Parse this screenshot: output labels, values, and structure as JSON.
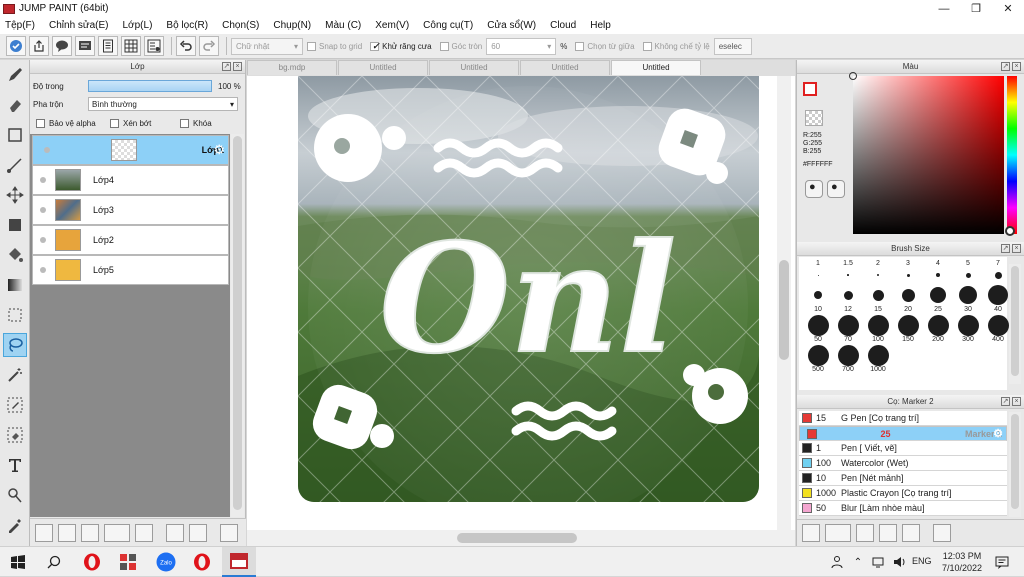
{
  "title": "JUMP PAINT (64bit)",
  "menu": [
    "Tệp(F)",
    "Chỉnh sửa(E)",
    "Lớp(L)",
    "Bộ lọc(R)",
    "Chọn(S)",
    "Chụp(N)",
    "Màu (C)",
    "Xem(V)",
    "Công cụ(T)",
    "Cửa sổ(W)",
    "Cloud",
    "Help"
  ],
  "toolbar": {
    "shape_select": "Chữ nhật",
    "snap_grid": "Snap to grid",
    "antialias": "Khử răng cưa",
    "corner": "Góc tròn",
    "corner_value": "60",
    "percent": "%",
    "center_select": "Chọn từ giữa",
    "no_ratio": "Không chế tỷ lệ",
    "deselect": "eselec"
  },
  "layers_panel": {
    "title": "Lớp",
    "opacity_label": "Độ trong",
    "opacity_value": "100 %",
    "blend_label": "Pha trộn",
    "blend_value": "Bình thường",
    "protect_alpha": "Bảo vệ alpha",
    "clip": "Xén bớt",
    "lock": "Khóa",
    "layers": [
      "Lớp1",
      "Lớp4",
      "Lớp3",
      "Lớp2",
      "Lớp5"
    ]
  },
  "tabs": [
    "bg.mdp",
    "Untitled",
    "Untitled",
    "Untitled",
    "Untitled"
  ],
  "artwork_text": "Onl",
  "color_panel": {
    "title": "Màu",
    "r": "R:255",
    "g": "G:255",
    "b": "B:255",
    "hex": "#FFFFFF"
  },
  "brush_size": {
    "title": "Brush Size",
    "sizes": [
      "1",
      "1.5",
      "2",
      "3",
      "4",
      "5",
      "7",
      "10",
      "12",
      "15",
      "20",
      "25",
      "30",
      "40",
      "50",
      "70",
      "100",
      "150",
      "200",
      "300",
      "400",
      "500",
      "700",
      "1000"
    ]
  },
  "brush_panel": {
    "title": "Cọ: Marker 2",
    "brushes": [
      {
        "size": "15",
        "name": "G Pen [Cọ trang trí]",
        "color": "#e53935"
      },
      {
        "size": "25",
        "name": "Marker 2",
        "color": "#e53935"
      },
      {
        "size": "1",
        "name": "Pen [ Viết, vẽ]",
        "color": "#222222"
      },
      {
        "size": "100",
        "name": "Watercolor (Wet)",
        "color": "#6fd0f0"
      },
      {
        "size": "10",
        "name": "Pen [Nét mảnh]",
        "color": "#222222"
      },
      {
        "size": "1000",
        "name": "Plastic Crayon [Cọ trang trí]",
        "color": "#f2e020"
      },
      {
        "size": "50",
        "name": "Blur [Làm nhòe màu]",
        "color": "#f4a6d0"
      }
    ]
  },
  "taskbar": {
    "lang": "ENG",
    "time": "12:03 PM",
    "date": "7/10/2022"
  }
}
